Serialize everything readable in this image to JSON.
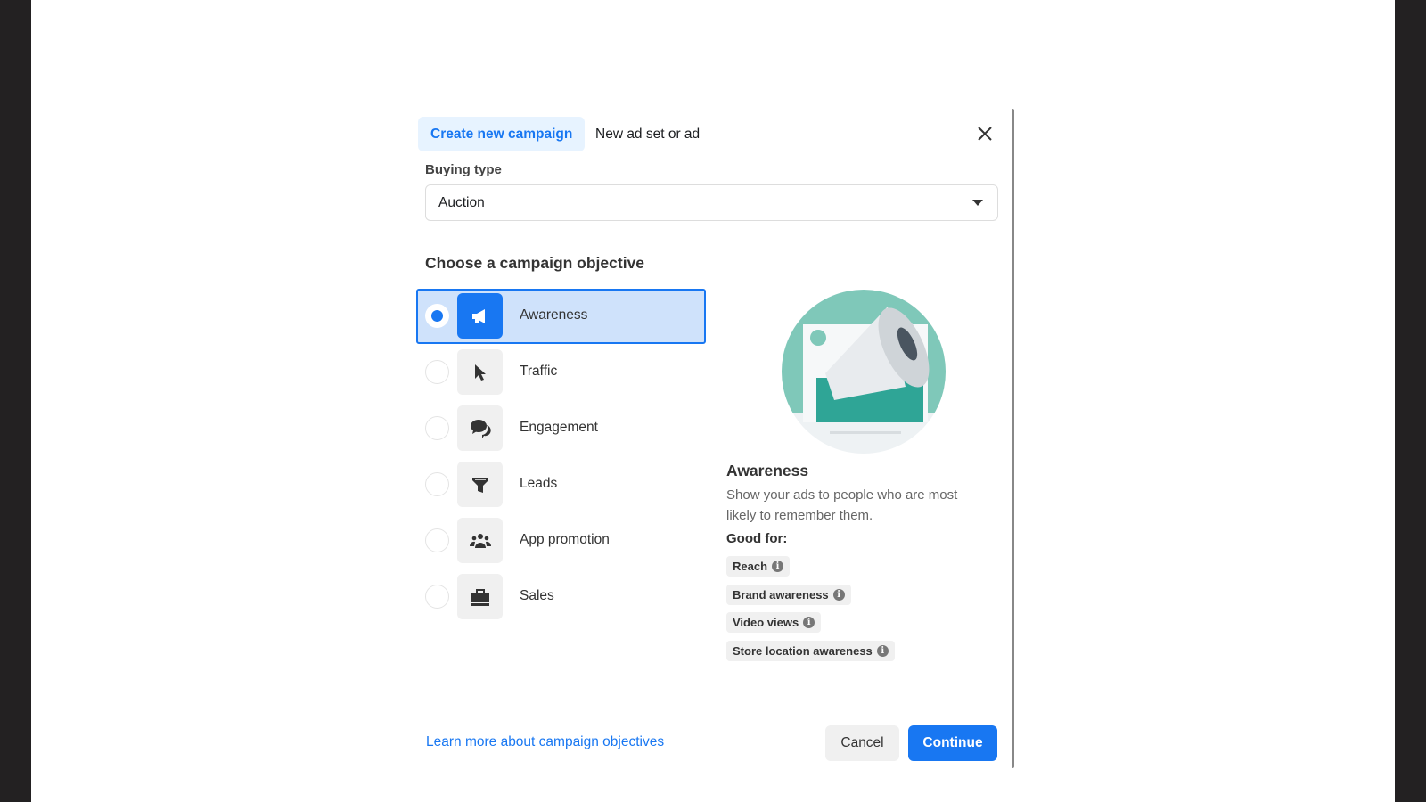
{
  "tabs": [
    {
      "label": "Create new campaign",
      "active": true
    },
    {
      "label": "New ad set or ad",
      "active": false
    }
  ],
  "buying_type": {
    "label": "Buying type",
    "value": "Auction"
  },
  "objective": {
    "heading": "Choose a campaign objective",
    "options": [
      {
        "label": "Awareness",
        "icon": "megaphone-icon",
        "selected": true
      },
      {
        "label": "Traffic",
        "icon": "cursor-icon",
        "selected": false
      },
      {
        "label": "Engagement",
        "icon": "chat-bubbles-icon",
        "selected": false
      },
      {
        "label": "Leads",
        "icon": "funnel-icon",
        "selected": false
      },
      {
        "label": "App promotion",
        "icon": "people-icon",
        "selected": false
      },
      {
        "label": "Sales",
        "icon": "shopping-bag-icon",
        "selected": false
      }
    ]
  },
  "detail": {
    "title": "Awareness",
    "description": "Show your ads to people who are most likely to remember them.",
    "good_for_label": "Good for:",
    "good_for": [
      "Reach",
      "Brand awareness",
      "Video views",
      "Store location awareness"
    ]
  },
  "footer": {
    "learn_more": "Learn more about campaign objectives",
    "cancel": "Cancel",
    "continue": "Continue"
  },
  "colors": {
    "accent": "#1877f2",
    "selected_bg": "#cfe2fb",
    "illustration_teal": "#7fc8b9"
  }
}
